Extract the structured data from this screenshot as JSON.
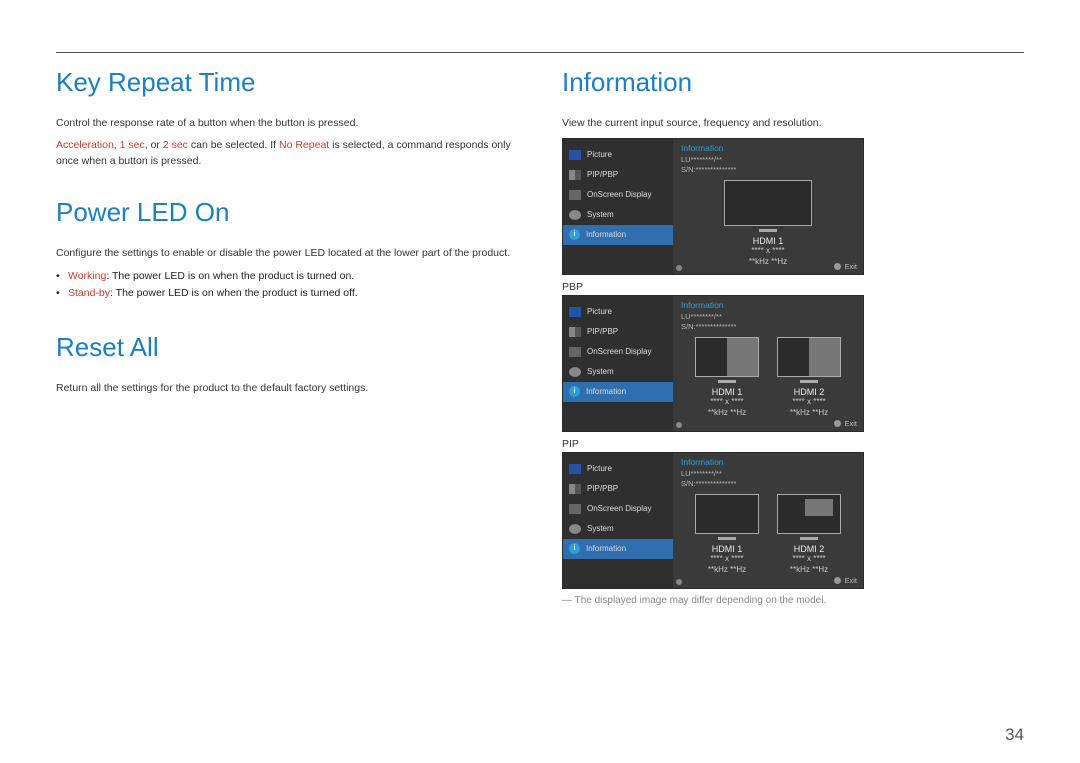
{
  "page_number": "34",
  "left": {
    "krt": {
      "title": "Key Repeat Time",
      "p1_a": "Control the response rate of a button when the button is pressed.",
      "p2_kw1": "Acceleration",
      "p2_mid1": ", ",
      "p2_kw2": "1 sec",
      "p2_mid2": ", or ",
      "p2_kw3": "2 sec",
      "p2_mid3": " can be selected. If ",
      "p2_kw4": "No Repeat",
      "p2_tail": " is selected, a command responds only once when a button is pressed."
    },
    "pled": {
      "title": "Power LED On",
      "p1": "Configure the settings to enable or disable the power LED located at the lower part of the product.",
      "b1_kw": "Working",
      "b1_txt": ": The power LED is on when the product is turned on.",
      "b2_kw": "Stand-by",
      "b2_txt": ": The power LED is on when the product is turned off."
    },
    "reset": {
      "title": "Reset All",
      "p1": "Return all the settings for the product to the default factory settings."
    }
  },
  "right": {
    "info": {
      "title": "Information",
      "p1": "View the current input source, frequency and resolution.",
      "caption_pbp": "PBP",
      "caption_pip": "PIP",
      "footnote": "― The displayed image may differ depending on the model."
    }
  },
  "osd": {
    "menu": {
      "picture": "Picture",
      "pippbp": "PIP/PBP",
      "onscreen": "OnScreen Display",
      "system": "System",
      "information": "Information"
    },
    "title": "Information",
    "model": "LU********/**",
    "sn": "S/N:**************",
    "hdmi1": "HDMI 1",
    "hdmi2": "HDMI 2",
    "res": "**** x ****",
    "freq": "**kHz **Hz",
    "exit": "Exit"
  }
}
